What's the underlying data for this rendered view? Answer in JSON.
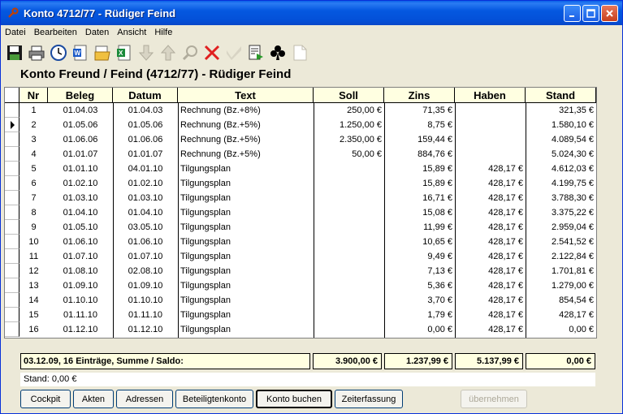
{
  "window": {
    "title": "Konto 4712/77 - Rüdiger Feind"
  },
  "menu": [
    "Datei",
    "Bearbeiten",
    "Daten",
    "Ansicht",
    "Hilfe"
  ],
  "toolbar": [
    "save-icon",
    "print-icon",
    "clock-icon",
    "word-doc-icon",
    "open-icon",
    "excel-icon",
    "arrow-down-icon",
    "arrow-up-icon",
    "search-icon",
    "delete-icon",
    "check-icon",
    "run-icon",
    "club-icon",
    "blank-page-icon"
  ],
  "heading": "Konto Freund / Feind (4712/77) - Rüdiger Feind",
  "columns": [
    "Nr",
    "Beleg",
    "Datum",
    "Text",
    "Soll",
    "Zins",
    "Haben",
    "Stand"
  ],
  "rows": [
    {
      "nr": "1",
      "beleg": "01.04.03",
      "datum": "01.04.03",
      "text": "Rechnung (Bz.+8%)",
      "soll": "250,00 €",
      "zins": "71,35 €",
      "haben": "",
      "stand": "321,35 €"
    },
    {
      "nr": "2",
      "beleg": "01.05.06",
      "datum": "01.05.06",
      "text": "Rechnung (Bz.+5%)",
      "soll": "1.250,00 €",
      "zins": "8,75 €",
      "haben": "",
      "stand": "1.580,10 €"
    },
    {
      "nr": "3",
      "beleg": "01.06.06",
      "datum": "01.06.06",
      "text": "Rechnung (Bz.+5%)",
      "soll": "2.350,00 €",
      "zins": "159,44 €",
      "haben": "",
      "stand": "4.089,54 €"
    },
    {
      "nr": "4",
      "beleg": "01.01.07",
      "datum": "01.01.07",
      "text": "Rechnung (Bz.+5%)",
      "soll": "50,00 €",
      "zins": "884,76 €",
      "haben": "",
      "stand": "5.024,30 €"
    },
    {
      "nr": "5",
      "beleg": "01.01.10",
      "datum": "04.01.10",
      "text": "Tilgungsplan",
      "soll": "",
      "zins": "15,89 €",
      "haben": "428,17 €",
      "stand": "4.612,03 €"
    },
    {
      "nr": "6",
      "beleg": "01.02.10",
      "datum": "01.02.10",
      "text": "Tilgungsplan",
      "soll": "",
      "zins": "15,89 €",
      "haben": "428,17 €",
      "stand": "4.199,75 €"
    },
    {
      "nr": "7",
      "beleg": "01.03.10",
      "datum": "01.03.10",
      "text": "Tilgungsplan",
      "soll": "",
      "zins": "16,71 €",
      "haben": "428,17 €",
      "stand": "3.788,30 €"
    },
    {
      "nr": "8",
      "beleg": "01.04.10",
      "datum": "01.04.10",
      "text": "Tilgungsplan",
      "soll": "",
      "zins": "15,08 €",
      "haben": "428,17 €",
      "stand": "3.375,22 €"
    },
    {
      "nr": "9",
      "beleg": "01.05.10",
      "datum": "03.05.10",
      "text": "Tilgungsplan",
      "soll": "",
      "zins": "11,99 €",
      "haben": "428,17 €",
      "stand": "2.959,04 €"
    },
    {
      "nr": "10",
      "beleg": "01.06.10",
      "datum": "01.06.10",
      "text": "Tilgungsplan",
      "soll": "",
      "zins": "10,65 €",
      "haben": "428,17 €",
      "stand": "2.541,52 €"
    },
    {
      "nr": "11",
      "beleg": "01.07.10",
      "datum": "01.07.10",
      "text": "Tilgungsplan",
      "soll": "",
      "zins": "9,49 €",
      "haben": "428,17 €",
      "stand": "2.122,84 €"
    },
    {
      "nr": "12",
      "beleg": "01.08.10",
      "datum": "02.08.10",
      "text": "Tilgungsplan",
      "soll": "",
      "zins": "7,13 €",
      "haben": "428,17 €",
      "stand": "1.701,81 €"
    },
    {
      "nr": "13",
      "beleg": "01.09.10",
      "datum": "01.09.10",
      "text": "Tilgungsplan",
      "soll": "",
      "zins": "5,36 €",
      "haben": "428,17 €",
      "stand": "1.279,00 €"
    },
    {
      "nr": "14",
      "beleg": "01.10.10",
      "datum": "01.10.10",
      "text": "Tilgungsplan",
      "soll": "",
      "zins": "3,70 €",
      "haben": "428,17 €",
      "stand": "854,54 €"
    },
    {
      "nr": "15",
      "beleg": "01.11.10",
      "datum": "01.11.10",
      "text": "Tilgungsplan",
      "soll": "",
      "zins": "1,79 €",
      "haben": "428,17 €",
      "stand": "428,17 €"
    },
    {
      "nr": "16",
      "beleg": "01.12.10",
      "datum": "01.12.10",
      "text": "Tilgungsplan",
      "soll": "",
      "zins": "0,00 €",
      "haben": "428,17 €",
      "stand": "0,00 €"
    }
  ],
  "selected_row": 1,
  "summary": {
    "label": "03.12.09, 16 Einträge, Summe / Saldo:",
    "soll": "3.900,00 €",
    "zins": "1.237,99 €",
    "haben": "5.137,99 €",
    "stand": "0,00 €"
  },
  "stand_text": "Stand: 0,00 €",
  "buttons": [
    "Cockpit",
    "Akten",
    "Adressen",
    "Beteiligtenkonto",
    "Konto buchen",
    "Zeiterfassung",
    "übernehmen"
  ]
}
